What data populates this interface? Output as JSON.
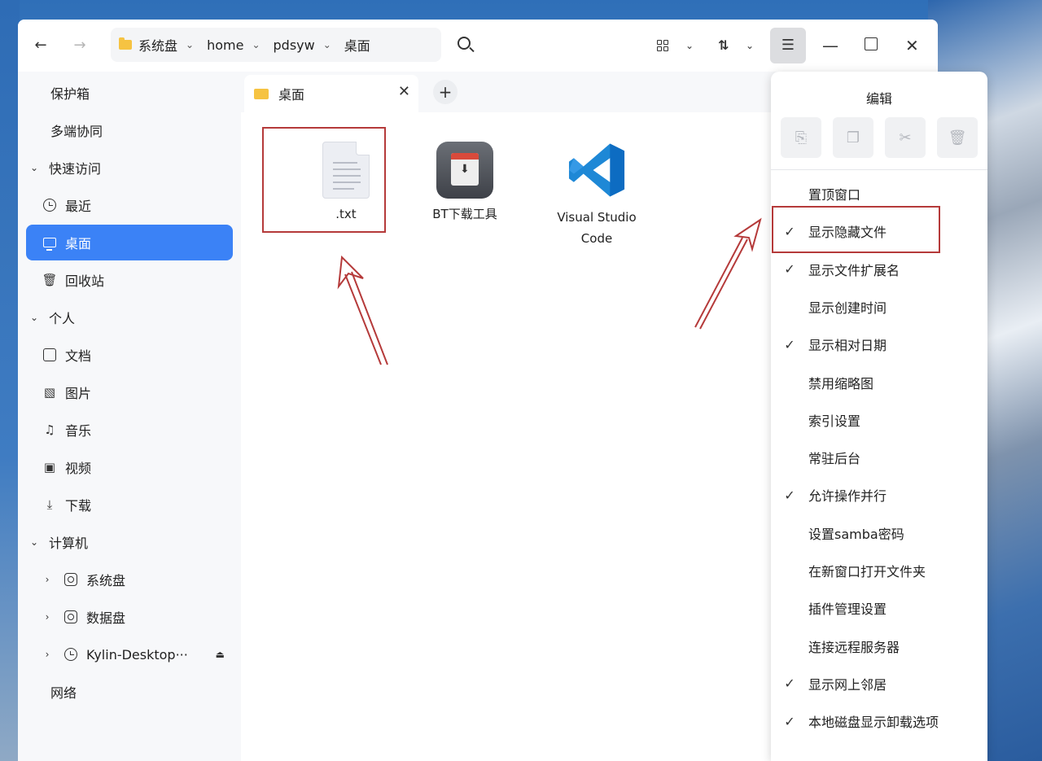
{
  "breadcrumb": [
    "系统盘",
    "home",
    "pdsyw",
    "桌面"
  ],
  "sidebar": {
    "items": [
      {
        "label": "保护箱",
        "type": "plain"
      },
      {
        "label": "多端协同",
        "type": "plain"
      },
      {
        "label": "快速访问",
        "type": "group"
      },
      {
        "label": "最近",
        "type": "child",
        "icon": "clock-icon"
      },
      {
        "label": "桌面",
        "type": "child",
        "icon": "desktop-icon",
        "active": true
      },
      {
        "label": "回收站",
        "type": "child",
        "icon": "trash-icon"
      },
      {
        "label": "个人",
        "type": "group"
      },
      {
        "label": "文档",
        "type": "child",
        "icon": "document-icon"
      },
      {
        "label": "图片",
        "type": "child",
        "icon": "image-icon"
      },
      {
        "label": "音乐",
        "type": "child",
        "icon": "music-icon"
      },
      {
        "label": "视频",
        "type": "child",
        "icon": "video-icon"
      },
      {
        "label": "下载",
        "type": "child",
        "icon": "download-icon"
      },
      {
        "label": "计算机",
        "type": "group"
      },
      {
        "label": "系统盘",
        "type": "drive",
        "icon": "disk-icon"
      },
      {
        "label": "数据盘",
        "type": "drive",
        "icon": "disk-icon"
      },
      {
        "label": "Kylin-Desktop···",
        "type": "drive",
        "icon": "cdrom-icon",
        "eject": true
      },
      {
        "label": "网络",
        "type": "plain"
      }
    ]
  },
  "tab": {
    "label": "桌面"
  },
  "files": [
    {
      "name": ".txt",
      "icon": "text-file-icon"
    },
    {
      "name": "BT下载工具",
      "icon": "bt-download-icon"
    },
    {
      "name": "Visual Studio Code",
      "icon": "vscode-icon"
    }
  ],
  "menu": {
    "title": "编辑",
    "edit_buttons": [
      "paste-icon",
      "copy-icon",
      "cut-icon",
      "delete-icon"
    ],
    "items": [
      {
        "label": "置顶窗口",
        "checked": false
      },
      {
        "label": "显示隐藏文件",
        "checked": true
      },
      {
        "label": "显示文件扩展名",
        "checked": true
      },
      {
        "label": "显示创建时间",
        "checked": false
      },
      {
        "label": "显示相对日期",
        "checked": true
      },
      {
        "label": "禁用缩略图",
        "checked": false
      },
      {
        "label": "索引设置",
        "checked": false
      },
      {
        "label": "常驻后台",
        "checked": false
      },
      {
        "label": "允许操作并行",
        "checked": true
      },
      {
        "label": "设置samba密码",
        "checked": false
      },
      {
        "label": "在新窗口打开文件夹",
        "checked": false
      },
      {
        "label": "插件管理设置",
        "checked": false
      },
      {
        "label": "连接远程服务器",
        "checked": false
      },
      {
        "label": "显示网上邻居",
        "checked": true
      },
      {
        "label": "本地磁盘显示卸载选项",
        "checked": true
      }
    ]
  },
  "colors": {
    "accent": "#3b82f6",
    "annotation": "#b53a3a",
    "folder": "#f6c342"
  }
}
